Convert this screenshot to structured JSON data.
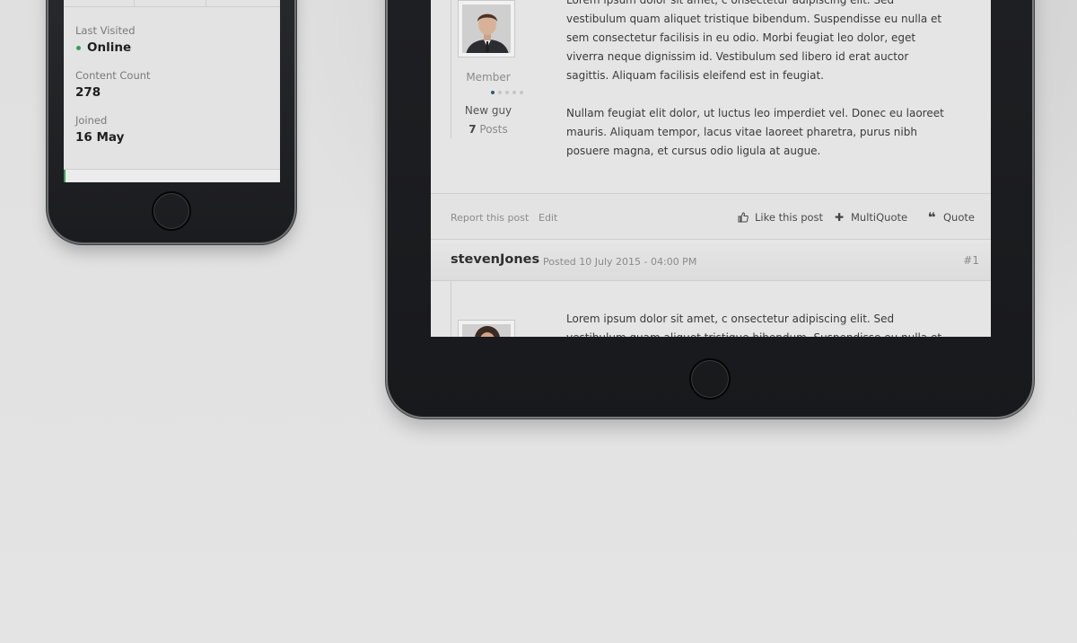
{
  "profile": {
    "last_visited_label": "Last Visited",
    "last_visited_value": "Online",
    "content_count_label": "Content Count",
    "content_count_value": "278",
    "joined_label": "Joined",
    "joined_value": "16 May",
    "status_color": "#3aa14a"
  },
  "post": {
    "author_group": "Member",
    "rank_pips_filled": 1,
    "rank_pips_total": 5,
    "rank_title": "New guy",
    "post_count": "7",
    "post_count_label": "Posts",
    "paragraphs": [
      "Lorem ipsum dolor sit amet, c onsectetur adipiscing elit. Sed vestibulum quam aliquet tristique bibendum. Suspendisse eu nulla et sem consectetur facilisis in eu odio. Morbi feugiat leo dolor, eget viverra neque dignissim id. Vestibulum sed libero id erat auctor sagittis. Aliquam facilisis eleifend est in feugiat.",
      "Nullam feugiat elit dolor, ut luctus leo imperdiet vel. Donec eu laoreet mauris. Aliquam tempor, lacus vitae laoreet pharetra, purus nibh posuere magna, et cursus odio ligula at augue."
    ]
  },
  "post_actions": {
    "report": "Report this post",
    "edit": "Edit",
    "like": "Like this post",
    "like_icon": "thumbs-up-icon",
    "multiquote": "MultiQuote",
    "multiquote_icon": "plus-icon",
    "quote": "Quote",
    "quote_icon": "quote-icon"
  },
  "next_post": {
    "author": "stevenJones",
    "posted": "Posted 10 July 2015 - 04:00 PM",
    "number": "#1",
    "text": "Lorem ipsum dolor sit amet, c onsectetur adipiscing elit. Sed vestibulum quam aliquet tristique bibendum. Suspendisse eu nulla et sem consectetur facilisis in eu"
  }
}
